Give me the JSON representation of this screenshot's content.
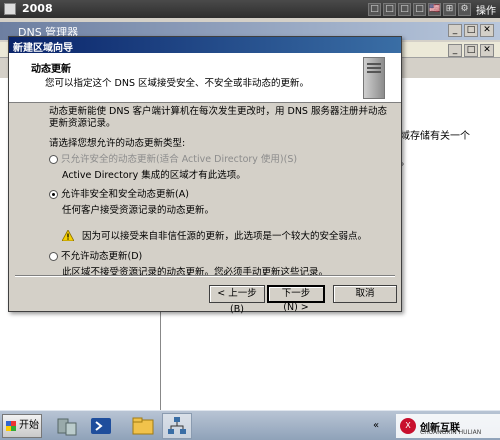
{
  "vm": {
    "title": "2008",
    "tools": [
      "□",
      "□",
      "□",
      "□",
      "🇺🇸",
      "⊞",
      "⚙"
    ],
    "action": "操作"
  },
  "dns_manager": {
    "title": "DNS 管理器",
    "background_text_1": "域存储有关一个",
    "background_text_2": "。"
  },
  "wizard": {
    "title": "新建区域向导",
    "header_title": "动态更新",
    "header_subtitle": "您可以指定这个 DNS 区域接受安全、不安全或非动态的更新。",
    "intro": "动态更新能使 DNS 客户端计算机在每次发生更改时，用 DNS 服务器注册并动态更新资源记录。",
    "prompt": "请选择您想允许的动态更新类型:",
    "options": [
      {
        "label": "只允许安全的动态更新(适合 Active Directory 使用)(S)",
        "desc": "Active Directory 集成的区域才有此选项。",
        "selected": false,
        "disabled": true
      },
      {
        "label": "允许非安全和安全动态更新(A)",
        "desc": "任何客户接受资源记录的动态更新。",
        "selected": true,
        "disabled": false
      },
      {
        "label": "不允许动态更新(D)",
        "desc": "此区域不接受资源记录的动态更新。您必须手动更新这些记录。",
        "selected": false,
        "disabled": false
      }
    ],
    "warning": "因为可以接受来自非信任源的更新，此选项是一个较大的安全弱点。",
    "buttons": {
      "back": "< 上一步(B)",
      "next": "下一步(N) >",
      "cancel": "取消"
    }
  },
  "taskbar": {
    "start_label": "开始",
    "tray_toggle": "«",
    "logo_text": "创新互联",
    "logo_sub": "CHUANGXIN HULIAN"
  }
}
